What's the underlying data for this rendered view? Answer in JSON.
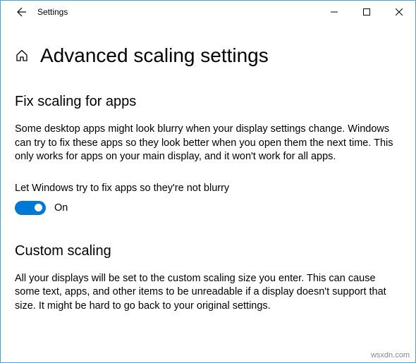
{
  "window": {
    "title": "Settings"
  },
  "page": {
    "title": "Advanced scaling settings"
  },
  "section1": {
    "heading": "Fix scaling for apps",
    "desc": "Some desktop apps might look blurry when your display settings change. Windows can try to fix these apps so they look better when you open them the next time. This only works for apps on your main display, and it won't work for all apps.",
    "toggle_label": "Let Windows try to fix apps so they're not blurry",
    "toggle_state": "On"
  },
  "section2": {
    "heading": "Custom scaling",
    "desc": "All your displays will be set to the custom scaling size you enter. This can cause some text, apps, and other items to be unreadable if a display doesn't support that size. It might be hard to go back to your original settings."
  },
  "watermark": "wsxdn.com"
}
